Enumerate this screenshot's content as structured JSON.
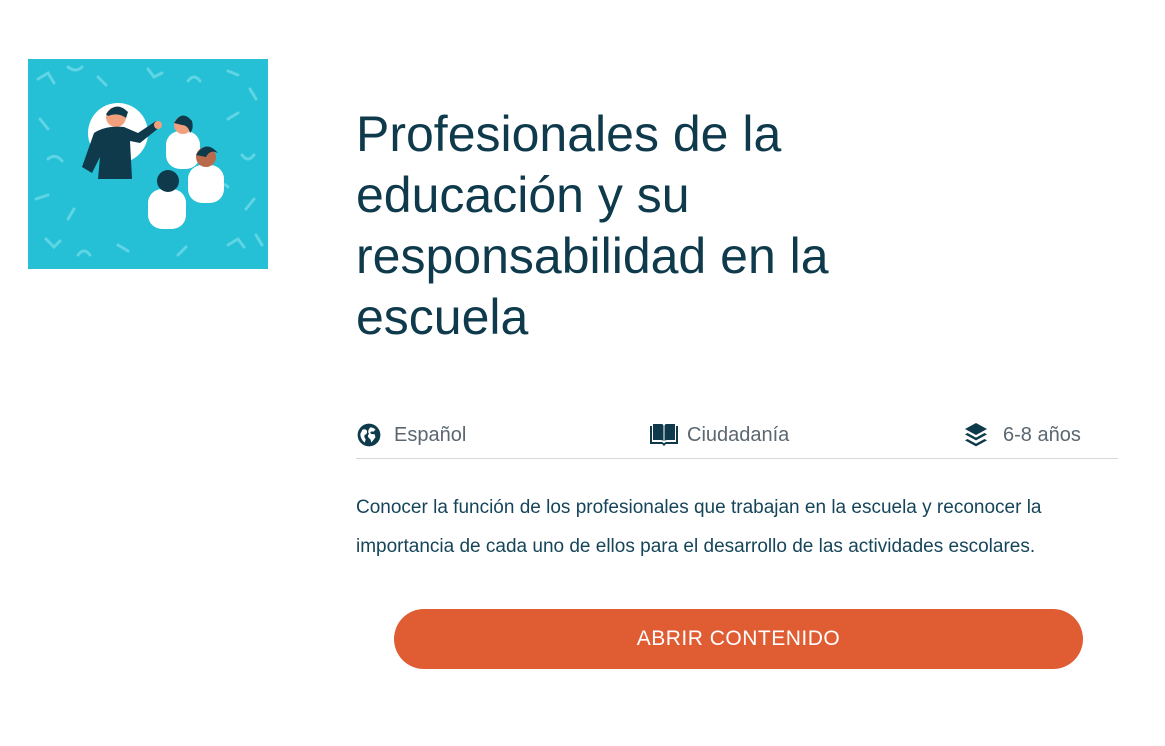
{
  "card": {
    "image_alt": "Ilustración de un docente y estudiantes",
    "title": "Profesionales de la educación y su responsabilidad en la escuela",
    "meta": {
      "language": "Español",
      "subject": "Ciudadanía",
      "age_range": "6-8 años"
    },
    "description": "Conocer la función de los profesionales que trabajan en la escuela y reconocer la importancia de cada uno de ellos para el desarrollo de las actividades escolares.",
    "cta_label": "ABRIR CONTENIDO"
  },
  "icons": {
    "language": "globe-icon",
    "subject": "open-book-icon",
    "age": "layers-icon"
  },
  "colors": {
    "title": "#0e3a4c",
    "meta_text": "#5b6770",
    "description": "#16455a",
    "cta_background": "#e05d33",
    "cta_text": "#ffffff",
    "thumbnail_background": "#25c0d6",
    "divider": "#d5d9dc"
  }
}
